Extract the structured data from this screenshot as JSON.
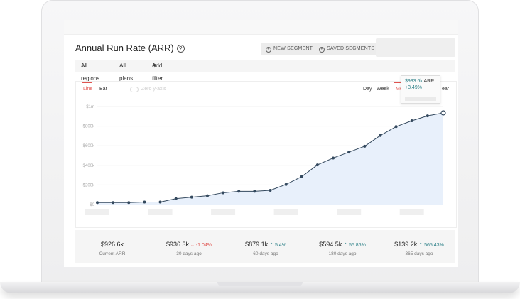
{
  "header": {
    "title": "Annual Run Rate (ARR)",
    "help_icon": "?"
  },
  "buttons": {
    "new_segment": "NEW SEGMENT",
    "saved_segments": "SAVED SEGMENTS"
  },
  "filters": {
    "regions": "All regions",
    "plans": "All plans",
    "add_filter": "Add filter"
  },
  "chart_controls": {
    "line": "Line",
    "bar": "Bar",
    "zero_axis": "Zero y-axis",
    "day": "Day",
    "week": "Week",
    "month": "Mo",
    "year": "ear"
  },
  "tooltip": {
    "value": "$933.6k",
    "label": "ARR",
    "change": "+3.49%"
  },
  "stats": [
    {
      "value": "$926.6k",
      "change": "",
      "dir": "",
      "label": "Current ARR"
    },
    {
      "value": "$936.3k",
      "change": "-1.04%",
      "dir": "down",
      "label": "30 days ago"
    },
    {
      "value": "$879.1k",
      "change": "5.4%",
      "dir": "up",
      "label": "60 days ago"
    },
    {
      "value": "$594.5k",
      "change": "55.86%",
      "dir": "up",
      "label": "180 days ago"
    },
    {
      "value": "$139.2k",
      "change": "565.43%",
      "dir": "up",
      "label": "365 days ago"
    }
  ],
  "colors": {
    "accent": "#e0534f",
    "line": "#34495e",
    "area": "#e8f0fb",
    "teal": "#2a7f86"
  },
  "chart_data": {
    "type": "area",
    "title": "",
    "ylabel": "",
    "ylim": [
      0,
      1000000
    ],
    "yticks": [
      "$0",
      "$200k",
      "$400k",
      "$600k",
      "$800k",
      "$1m"
    ],
    "grid": true,
    "series": [
      {
        "name": "ARR",
        "values": [
          20000,
          20000,
          20000,
          25000,
          25000,
          60000,
          75000,
          90000,
          120000,
          135000,
          135000,
          145000,
          205000,
          285000,
          405000,
          475000,
          535000,
          595000,
          705000,
          795000,
          855000,
          905000,
          935000
        ]
      }
    ]
  }
}
